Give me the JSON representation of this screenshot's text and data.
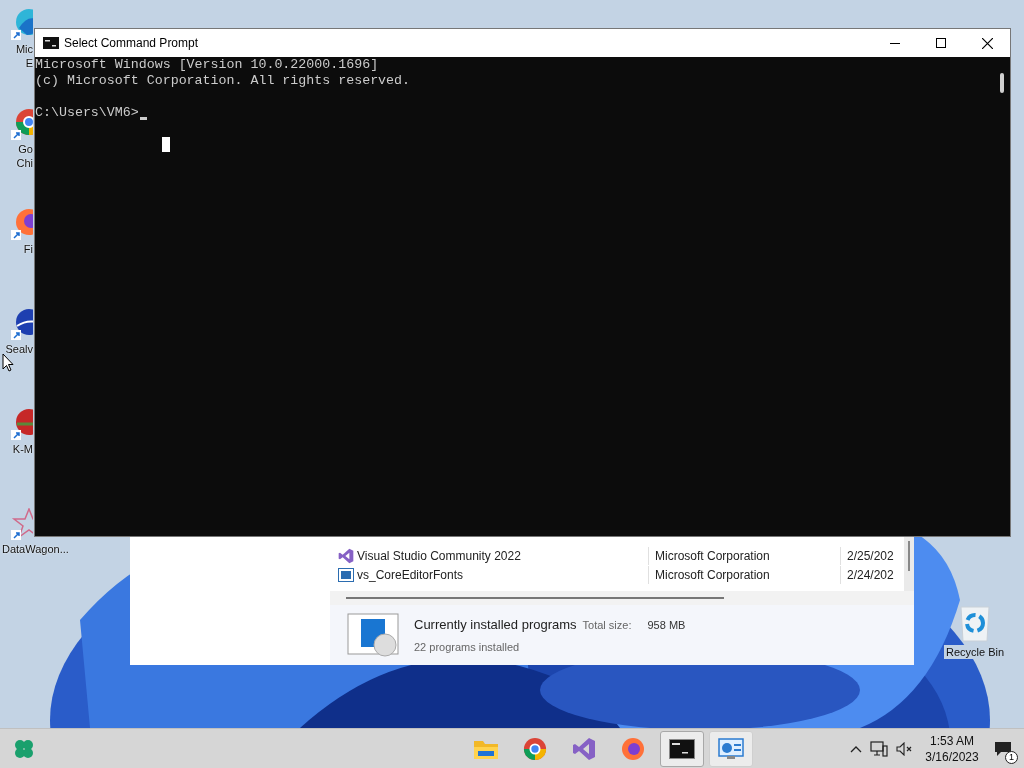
{
  "desktop_icons": [
    {
      "kind": "edge",
      "lines": [
        "Mic",
        "E"
      ]
    },
    {
      "kind": "chrome",
      "lines": [
        "Go",
        "Chi"
      ]
    },
    {
      "kind": "firefox",
      "lines": [
        "Fi"
      ]
    },
    {
      "kind": "sphere",
      "lines": [
        "Sealv"
      ]
    },
    {
      "kind": "player",
      "lines": [
        "K-M"
      ]
    },
    {
      "kind": "star",
      "lines": [
        "DataWagon..."
      ]
    }
  ],
  "recycle_bin": {
    "label": "Recycle Bin"
  },
  "programs_window": {
    "rows": [
      {
        "kind": "studio",
        "name": "Visual Studio Community 2022",
        "publisher": "Microsoft Corporation",
        "installed": "2/25/202"
      },
      {
        "kind": "fonts",
        "name": "vs_CoreEditorFonts",
        "publisher": "Microsoft Corporation",
        "installed": "2/24/202"
      }
    ],
    "summary": {
      "title": "Currently installed programs",
      "size_label": "Total size:",
      "size": "958 MB",
      "count": "22 programs installed"
    }
  },
  "cmd_window": {
    "title": "Select Command Prompt",
    "lines": [
      "Microsoft Windows [Version 10.0.22000.1696]",
      "(c) Microsoft Corporation. All rights reserved."
    ],
    "prompt": "C:\\Users\\VM6>"
  },
  "taskbar": {
    "apps": [
      {
        "kind": "folder",
        "selected": false,
        "open": false
      },
      {
        "kind": "chrome",
        "selected": false,
        "open": false
      },
      {
        "kind": "studio",
        "selected": false,
        "open": false
      },
      {
        "kind": "firefox",
        "selected": false,
        "open": false
      },
      {
        "kind": "terminal",
        "selected": true,
        "open": true
      },
      {
        "kind": "control",
        "selected": false,
        "open": true
      }
    ],
    "time": "1:53 AM",
    "date": "3/16/2023",
    "notifications": "1"
  }
}
